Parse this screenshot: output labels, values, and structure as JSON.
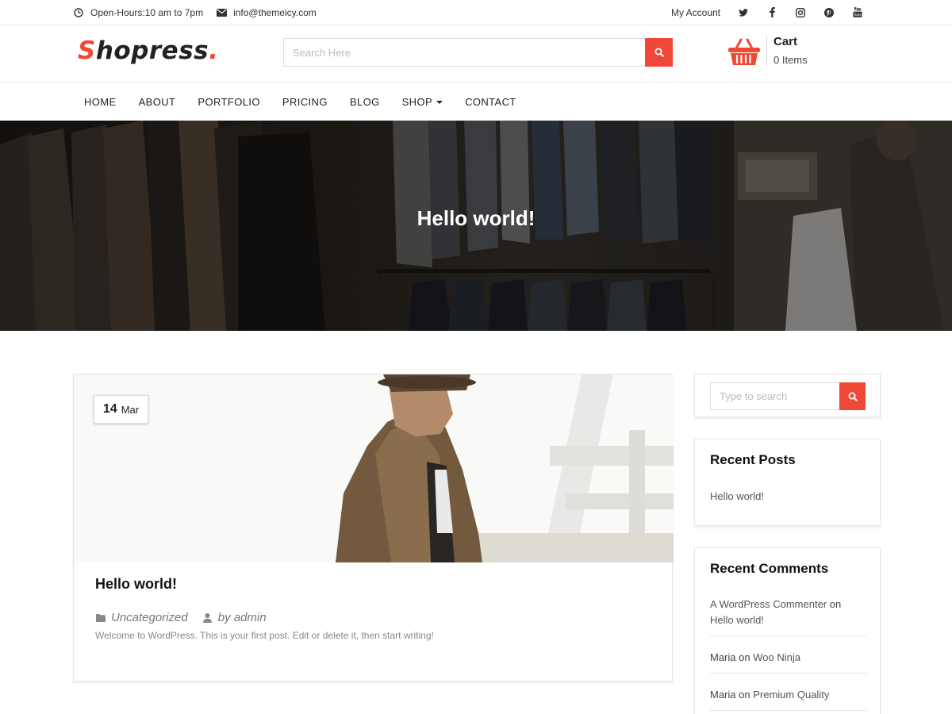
{
  "topbar": {
    "hours": "Open-Hours:10 am to 7pm",
    "email": "info@themeicy.com",
    "account": "My Account",
    "social": [
      "twitter-icon",
      "facebook-icon",
      "instagram-icon",
      "pinterest-icon",
      "youtube-icon"
    ]
  },
  "header": {
    "logo_first": "S",
    "logo_rest": "hopress",
    "logo_dot": ".",
    "search_placeholder": "Search Here",
    "cart_title": "Cart",
    "cart_count": "0 Items"
  },
  "nav": {
    "items": [
      "HOME",
      "ABOUT",
      "PORTFOLIO",
      "PRICING",
      "BLOG",
      "SHOP",
      "CONTACT"
    ]
  },
  "hero": {
    "title": "Hello world!"
  },
  "post": {
    "day": "14",
    "month": "Mar",
    "title": "Hello world!",
    "category": "Uncategorized",
    "author": "by admin",
    "excerpt": "Welcome to WordPress. This is your first post. Edit or delete it, then start writing!"
  },
  "sidebar": {
    "search_placeholder": "Type to search",
    "recent_posts_title": "Recent Posts",
    "recent_posts": [
      "Hello world!"
    ],
    "recent_comments_title": "Recent Comments",
    "comments": [
      {
        "author": "A WordPress Commenter",
        "on": "on",
        "post": "Hello world!"
      },
      {
        "author": "Maria",
        "on": "on",
        "post": "Woo Ninja"
      },
      {
        "author": "Maria",
        "on": "on",
        "post": "Premium Quality"
      }
    ]
  },
  "colors": {
    "accent": "#ef4836",
    "text": "#222222"
  }
}
